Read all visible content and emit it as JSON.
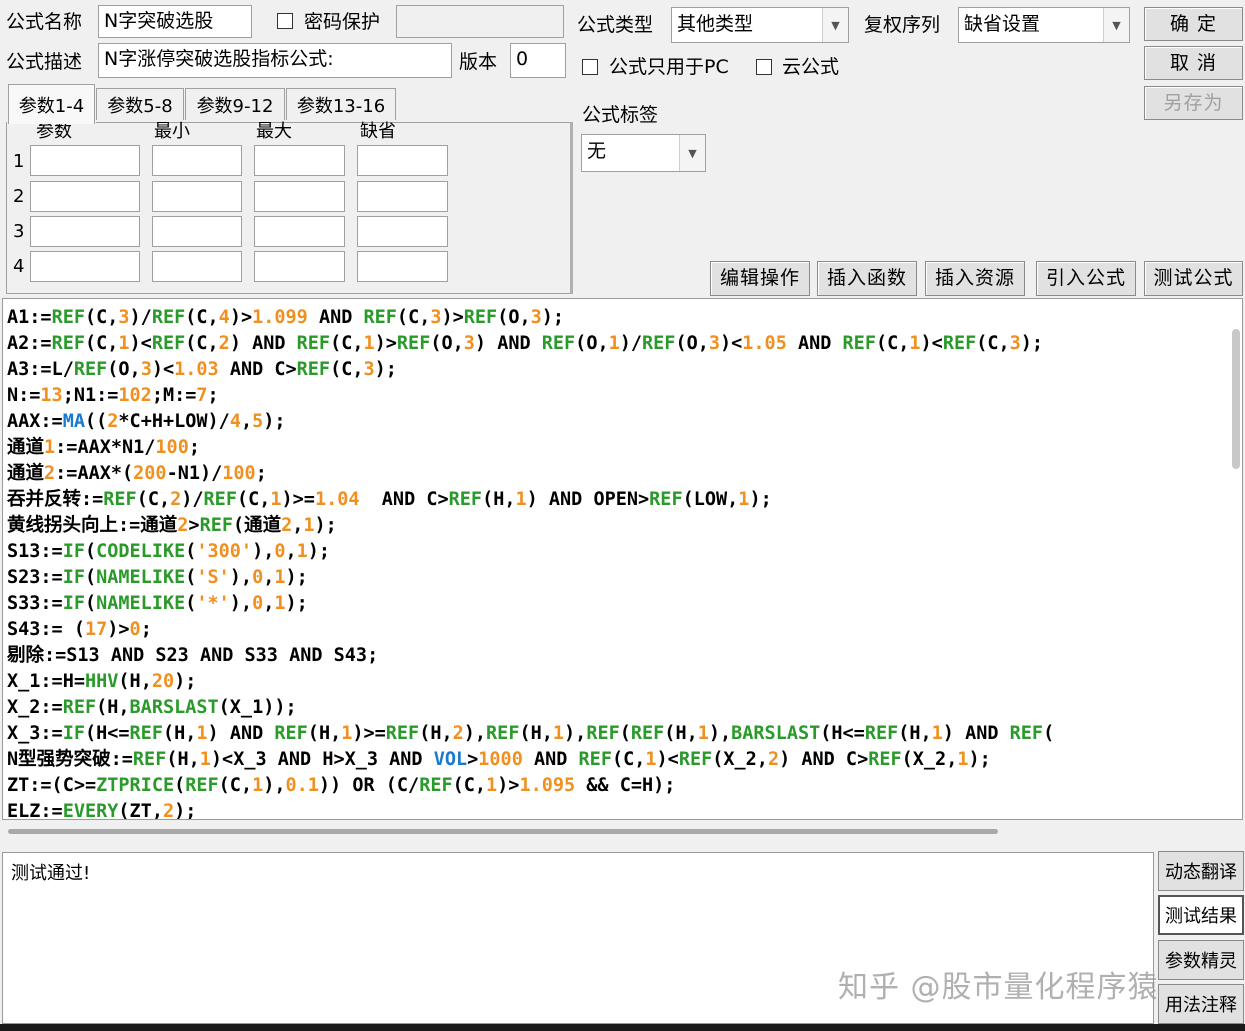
{
  "header": {
    "name_label": "公式名称",
    "name_value": "N字突破选股",
    "password_label": "密码保护",
    "desc_label": "公式描述",
    "desc_value": "N字涨停突破选股指标公式:",
    "version_label": "版本",
    "version_value": "0",
    "type_label": "公式类型",
    "type_value": "其他类型",
    "rights_label": "复权序列",
    "rights_value": "缺省设置",
    "pc_only_label": "公式只用于PC",
    "cloud_label": "云公式",
    "tag_label": "公式标签",
    "tag_value": "无"
  },
  "buttons": {
    "ok": "确 定",
    "cancel": "取 消",
    "save_as": "另存为",
    "edit_ops": "编辑操作",
    "insert_func": "插入函数",
    "insert_res": "插入资源",
    "import_formula": "引入公式",
    "test_formula": "测试公式"
  },
  "params": {
    "tabs": [
      "参数1-4",
      "参数5-8",
      "参数9-12",
      "参数13-16"
    ],
    "columns": [
      "参数",
      "最小",
      "最大",
      "缺省"
    ],
    "rows": [
      "1",
      "2",
      "3",
      "4"
    ]
  },
  "code": {
    "lines": [
      "A1:=REF(C,3)/REF(C,4)>1.099 AND REF(C,3)>REF(O,3);",
      "A2:=REF(C,1)<REF(C,2) AND REF(C,1)>REF(O,3) AND REF(O,1)/REF(O,3)<1.05 AND REF(C,1)<REF(C,3);",
      "A3:=L/REF(O,3)<1.03 AND C>REF(C,3);",
      "N:=13;N1:=102;M:=7;",
      "AAX:=MA((2*C+H+LOW)/4,5);",
      "通道1:=AAX*N1/100;",
      "通道2:=AAX*(200-N1)/100;",
      "吞并反转:=REF(C,2)/REF(C,1)>=1.04  AND C>REF(H,1) AND OPEN>REF(LOW,1);",
      "黄线拐头向上:=通道2>REF(通道2,1);",
      "S13:=IF(CODELIKE('300'),0,1);",
      "S23:=IF(NAMELIKE('S'),0,1);",
      "S33:=IF(NAMELIKE('*'),0,1);",
      "S43:= (17)>0;",
      "剔除:=S13 AND S23 AND S33 AND S43;",
      "X_1:=H=HHV(H,20);",
      "X_2:=REF(H,BARSLAST(X_1));",
      "X_3:=IF(H<=REF(H,1) AND REF(H,1)>=REF(H,2),REF(H,1),REF(REF(H,1),BARSLAST(H<=REF(H,1) AND REF(",
      "N型强势突破:=REF(H,1)<X_3 AND H>X_3 AND VOL>1000 AND REF(C,1)<REF(X_2,2) AND C>REF(X_2,1);",
      "ZT:=(C>=ZTPRICE(REF(C,1),0.1)) OR (C/REF(C,1)>1.095 && C=H);",
      "ELZ:=EVERY(ZT,2);"
    ]
  },
  "result": {
    "text": "测试通过!"
  },
  "side_buttons": [
    "动态翻译",
    "测试结果",
    "参数精灵",
    "用法注释"
  ],
  "watermark": "知乎 @股市量化程序猿",
  "colors": {
    "function": "#2a9a2a",
    "number": "#f09020",
    "special": "#1a7ad0"
  }
}
